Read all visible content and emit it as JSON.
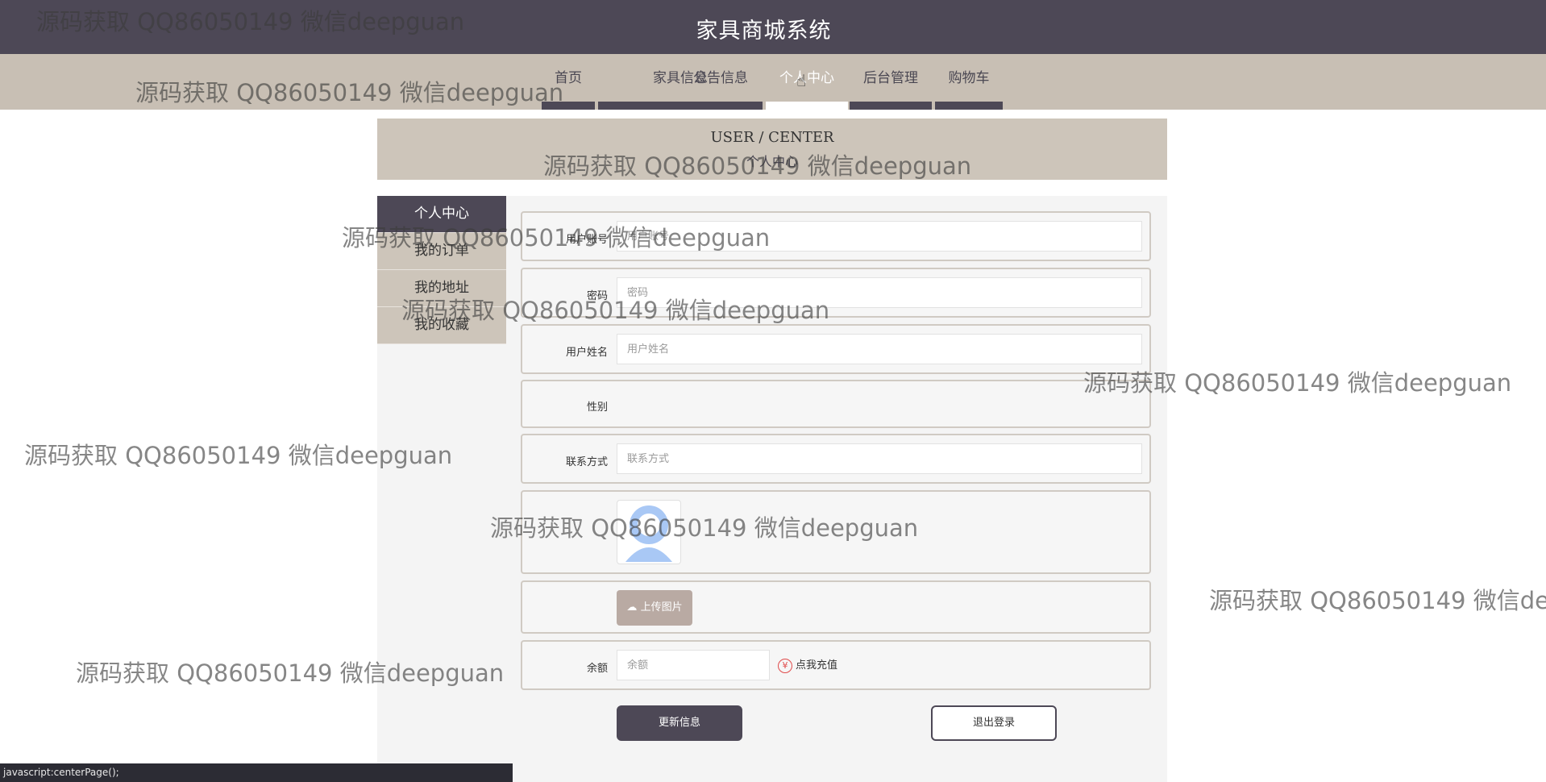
{
  "header": {
    "site_title": "家具商城系统"
  },
  "nav": {
    "items": [
      {
        "label": "首页"
      },
      {
        "label": "家具信息"
      },
      {
        "label": "公告信息"
      },
      {
        "label": "个人中心",
        "active": true
      },
      {
        "label": "后台管理"
      },
      {
        "label": "购物车"
      }
    ]
  },
  "banner": {
    "title_en": "USER / CENTER",
    "title_cn": "个人中心"
  },
  "sidebar": {
    "items": [
      {
        "label": "个人中心",
        "active": true
      },
      {
        "label": "我的订单"
      },
      {
        "label": "我的地址"
      },
      {
        "label": "我的收藏"
      }
    ]
  },
  "form": {
    "username": {
      "label": "用户账号",
      "placeholder": "用户账号",
      "value": ""
    },
    "password": {
      "label": "密码",
      "placeholder": "密码",
      "value": ""
    },
    "realname": {
      "label": "用户姓名",
      "placeholder": "用户姓名",
      "value": ""
    },
    "gender": {
      "label": "性别"
    },
    "phone": {
      "label": "联系方式",
      "placeholder": "联系方式",
      "value": ""
    },
    "avatar": {
      "icon": "user-avatar-icon"
    },
    "upload": {
      "label": "上传图片",
      "icon": "cloud-upload-icon"
    },
    "balance": {
      "label": "余额",
      "placeholder": "余额",
      "value": "",
      "recharge_label": "点我充值",
      "recharge_icon": "yen-icon",
      "recharge_icon_glyph": "¥"
    }
  },
  "actions": {
    "update_label": "更新信息",
    "logout_label": "退出登录"
  },
  "status_bar": {
    "text": "javascript:centerPage();"
  },
  "watermark": {
    "text": "源码获取 QQ86050149 微信deepguan"
  },
  "colors": {
    "header_bg": "#4d4856",
    "nav_bg": "#c8bfb4",
    "banner_bg": "#cdc5ba",
    "accent": "#b9aaa3"
  }
}
